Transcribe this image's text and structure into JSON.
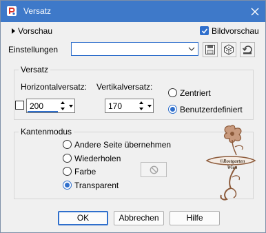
{
  "window": {
    "title": "Versatz"
  },
  "preview": {
    "label": "Vorschau",
    "live_preview_label": "Bildvorschau",
    "live_preview_checked": true
  },
  "settings": {
    "label": "Einstellungen",
    "preset_value": ""
  },
  "offset": {
    "group_title": "Versatz",
    "horizontal_label": "Horizontalversatz:",
    "horizontal_value": "200",
    "vertical_label": "Vertikalversatz:",
    "vertical_value": "170",
    "centered_label": "Zentriert",
    "custom_label": "Benutzerdefiniert",
    "selected": "custom"
  },
  "edge_mode": {
    "group_title": "Kantenmodus",
    "options": [
      "Andere Seite übernehmen",
      "Wiederholen",
      "Farbe",
      "Transparent"
    ],
    "selected": "Transparent"
  },
  "buttons": {
    "ok": "OK",
    "cancel": "Abbrechen",
    "help": "Hilfe"
  },
  "watermark": {
    "line1": "©Rostgarten",
    "line2": "Wien"
  },
  "colors": {
    "accent": "#2f6fcc",
    "titlebar": "#3e79c9",
    "watermark": "#8c5a3a"
  },
  "icons": [
    "app-icon",
    "close-icon",
    "expand-triangle-icon",
    "save-preset-icon",
    "load-preset-icon",
    "reset-icon",
    "spin-up-icon",
    "spin-down-icon",
    "no-color-icon"
  ]
}
